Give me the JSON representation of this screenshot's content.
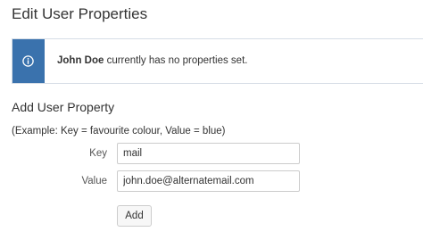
{
  "page": {
    "title": "Edit User Properties"
  },
  "info_banner": {
    "user_name": "John Doe",
    "message_suffix": " currently has no properties set.",
    "icon": "info-icon",
    "accent_color": "#3a72ad"
  },
  "add_property": {
    "section_title": "Add User Property",
    "example": "(Example: Key = favourite colour, Value = blue)",
    "key_label": "Key",
    "key_value": "mail",
    "value_label": "Value",
    "value_value": "john.doe@alternatemail.com",
    "add_button_label": "Add"
  }
}
